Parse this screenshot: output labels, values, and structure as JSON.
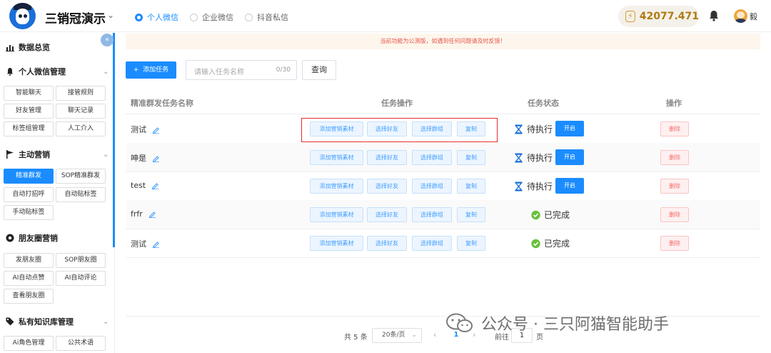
{
  "header": {
    "app_title": "三销冠演示",
    "tabs": [
      {
        "label": "个人微信",
        "selected": true
      },
      {
        "label": "企业微信",
        "selected": false
      },
      {
        "label": "抖音私信",
        "selected": false
      }
    ],
    "balance": "42077.471",
    "user_name": "毅",
    "accent": "#1a8cff"
  },
  "sidebar": {
    "sections": [
      {
        "title": "数据总览",
        "icon": "bar-chart-icon",
        "items": []
      },
      {
        "title": "个人微信管理",
        "icon": "bell-icon",
        "items": [
          "智能聊天",
          "接管规则",
          "好友管理",
          "聊天记录",
          "标签组管理",
          "人工介入"
        ]
      },
      {
        "title": "主动营销",
        "icon": "flag-icon",
        "items": [
          "精准群发",
          "SOP精准群发",
          "自动打招呼",
          "自动贴标签",
          "手动贴标签"
        ],
        "active_item": "精准群发"
      },
      {
        "title": "朋友圈营销",
        "icon": "camera-icon",
        "items": [
          "发朋友圈",
          "SOP朋友圈",
          "AI自动点赞",
          "AI自动评论",
          "查看朋友圈"
        ]
      },
      {
        "title": "私有知识库管理",
        "icon": "tag-icon",
        "items": [
          "Ai角色管理",
          "公共术语"
        ]
      }
    ]
  },
  "main": {
    "notice": "当前功能为公测版，如遇到任何问题请及时反馈！",
    "add_button": "添加任务",
    "search_placeholder": "请输入任务名称",
    "search_count": "0/30",
    "query_button": "查询",
    "columns": [
      "精准群发任务名称",
      "任务操作",
      "任务状态",
      "操作"
    ],
    "op_labels": [
      "添加营销素材",
      "选择好友",
      "选择群组",
      "复制"
    ],
    "open_label": "开启",
    "delete_label": "删除",
    "rows": [
      {
        "name": "测试",
        "status": "待执行",
        "done": false
      },
      {
        "name": "呻是",
        "status": "待执行",
        "done": false
      },
      {
        "name": "test",
        "status": "待执行",
        "done": false
      },
      {
        "name": "frfr",
        "status": "已完成",
        "done": true
      },
      {
        "name": "测试",
        "status": "已完成",
        "done": true
      }
    ]
  },
  "pagination": {
    "total": "共 5 条",
    "page_size": "20条/页",
    "current_page": "1",
    "goto_prefix": "前往",
    "goto_value": "1",
    "goto_suffix": "页"
  },
  "watermark": "公众号 · 三只阿猫智能助手"
}
